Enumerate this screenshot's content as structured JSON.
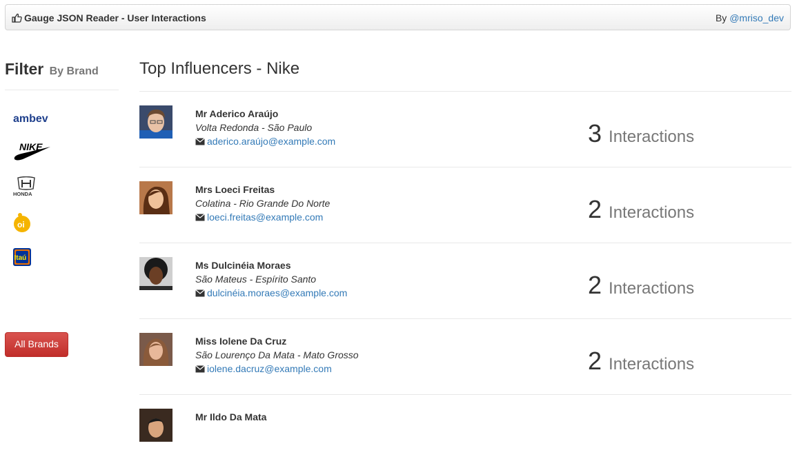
{
  "header": {
    "title": "Gauge JSON Reader - User Interactions",
    "by": "By",
    "author": "@mriso_dev"
  },
  "sidebar": {
    "title": "Filter",
    "subtitle": "By Brand",
    "brands": [
      "ambev",
      "NIKE",
      "HONDA",
      "oi",
      "Itaú"
    ],
    "all_brands": "All Brands"
  },
  "main": {
    "title": "Top Influencers - Nike",
    "interactions_label": "Interactions",
    "rows": [
      {
        "name": "Mr Aderico Araújo",
        "location": "Volta Redonda - São Paulo",
        "email": "aderico.araújo@example.com",
        "count": "3"
      },
      {
        "name": "Mrs Loeci Freitas",
        "location": "Colatina - Rio Grande Do Norte",
        "email": "loeci.freitas@example.com",
        "count": "2"
      },
      {
        "name": "Ms Dulcinéia Moraes",
        "location": "São Mateus - Espírito Santo",
        "email": "dulcinéia.moraes@example.com",
        "count": "2"
      },
      {
        "name": "Miss Iolene Da Cruz",
        "location": "São Lourenço Da Mata - Mato Grosso",
        "email": "iolene.dacruz@example.com",
        "count": "2"
      },
      {
        "name": "Mr Ildo Da Mata"
      }
    ]
  },
  "colors": {
    "link": "#337ab7",
    "danger": "#d9534f",
    "ambev": "#1e3f8c",
    "oi": "#f5b400",
    "itau_bg": "#ec7000",
    "itau_box": "#003399"
  }
}
